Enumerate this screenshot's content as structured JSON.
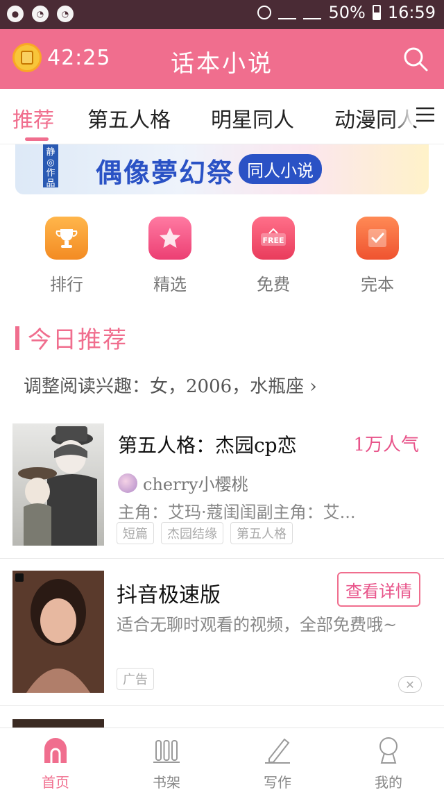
{
  "status_bar": {
    "battery": "50%",
    "time": "16:59"
  },
  "app_bar": {
    "timer": "42:25",
    "title": "话本小说"
  },
  "tabs": [
    {
      "label": "推荐",
      "active": true
    },
    {
      "label": "第五人格"
    },
    {
      "label": "明星同人"
    },
    {
      "label": "动漫同人"
    }
  ],
  "banner": {
    "tag": "静◎作品",
    "title": "偶像夢幻祭",
    "subtitle": "同人小说"
  },
  "quick_entries": [
    {
      "label": "排行",
      "icon": "trophy-icon",
      "color": "#f7a23a"
    },
    {
      "label": "精选",
      "icon": "star-icon",
      "color": "#f25a86"
    },
    {
      "label": "免费",
      "icon": "free-tag-icon",
      "color": "#f04f6d"
    },
    {
      "label": "完本",
      "icon": "checkbox-icon",
      "color": "#f5683c"
    }
  ],
  "section": {
    "title": "今日推荐",
    "interest": "调整阅读兴趣：女，2006，水瓶座 ›"
  },
  "book": {
    "title": "第五人格：杰园cp恋",
    "popularity": "1万人气",
    "author": "cherry小樱桃",
    "description": "主角：艾玛·蔻闺闺副主角：艾...",
    "tags": [
      "短篇",
      "杰园结缘",
      "第五人格"
    ]
  },
  "ad": {
    "title": "抖音极速版",
    "button": "查看详情",
    "description": "适合无聊时观看的视频，全部免费哦~",
    "label": "广告"
  },
  "bottom_nav": [
    {
      "label": "首页",
      "active": true,
      "icon": "home-icon"
    },
    {
      "label": "书架",
      "icon": "bookshelf-icon"
    },
    {
      "label": "写作",
      "icon": "pen-icon"
    },
    {
      "label": "我的",
      "icon": "profile-icon"
    }
  ],
  "colors": {
    "accent": "#f06e8e",
    "status_bar": "#4a2b35"
  }
}
